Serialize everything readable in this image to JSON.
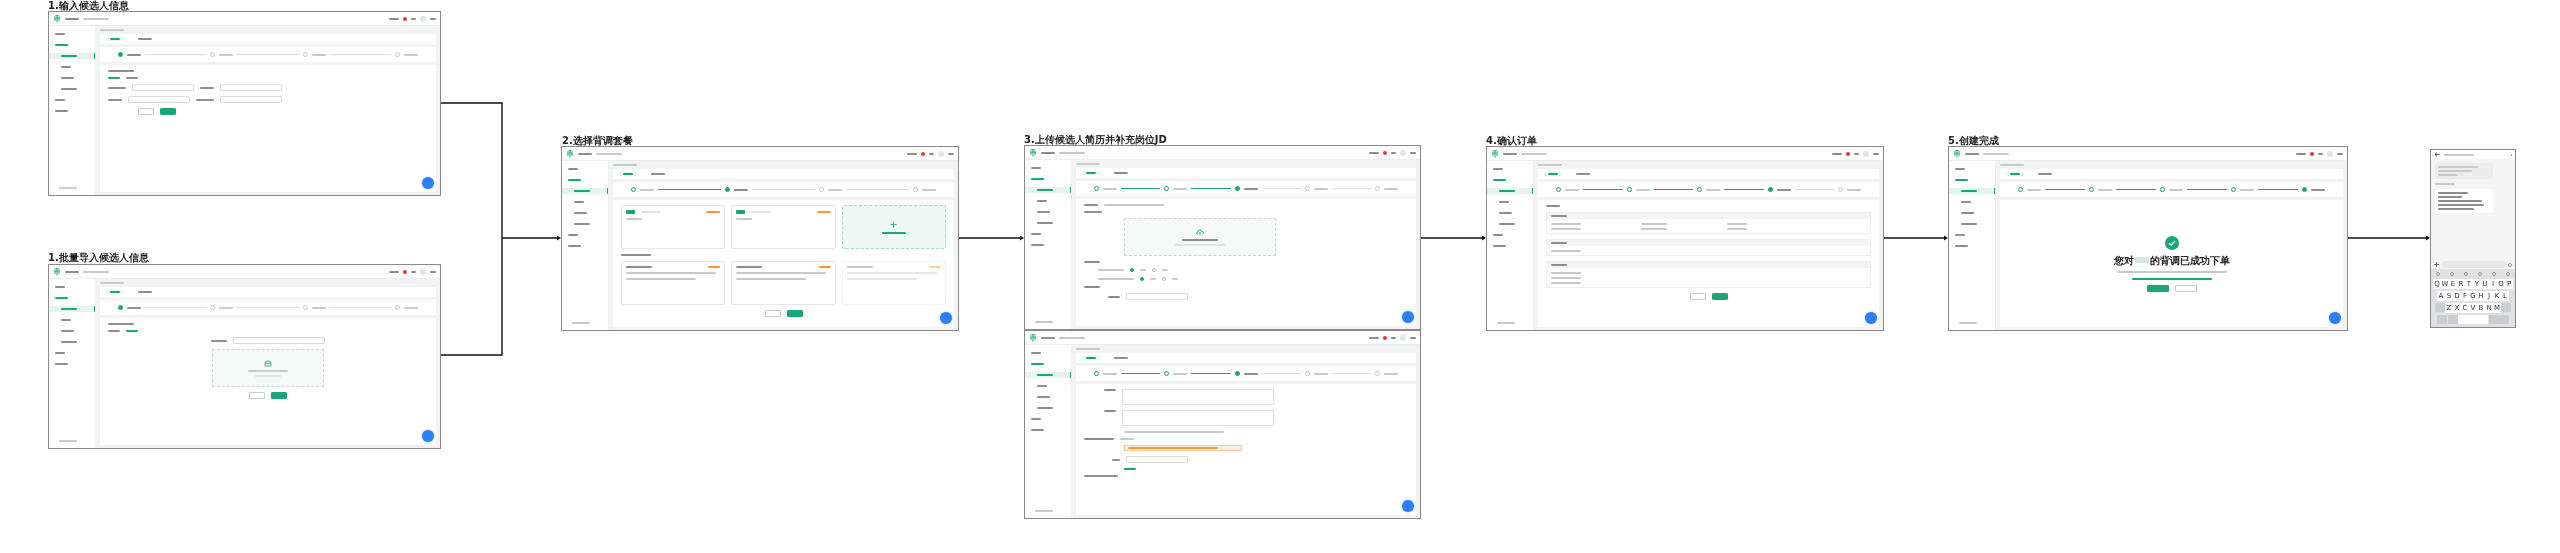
{
  "frames": [
    {
      "title": "1.输入候选人信息",
      "kind": "form",
      "sidebar": [
        {
          "selected": false
        },
        {
          "selected": false
        },
        {
          "selected": true
        },
        {
          "selected": false
        },
        {
          "selected": false
        },
        {
          "selected": false
        },
        {
          "selected": false
        },
        {
          "selected": false
        }
      ],
      "steps": [
        {
          "done": false,
          "current": true
        },
        {
          "done": false,
          "current": false
        },
        {
          "done": false,
          "current": false
        },
        {
          "done": false,
          "current": false
        }
      ]
    },
    {
      "title": "1.批量导入候选人信息",
      "kind": "upload",
      "sidebar": [
        {
          "selected": false
        },
        {
          "selected": false
        },
        {
          "selected": true
        },
        {
          "selected": false
        },
        {
          "selected": false
        },
        {
          "selected": false
        },
        {
          "selected": false
        },
        {
          "selected": false
        }
      ],
      "steps": [
        {
          "done": false,
          "current": true
        },
        {
          "done": false,
          "current": false
        },
        {
          "done": false,
          "current": false
        },
        {
          "done": false,
          "current": false
        }
      ]
    },
    {
      "title": "2.选择背调套餐",
      "kind": "packages",
      "sidebar": [
        {
          "selected": false
        },
        {
          "selected": false
        },
        {
          "selected": true
        },
        {
          "selected": false
        },
        {
          "selected": false
        },
        {
          "selected": false
        },
        {
          "selected": false
        },
        {
          "selected": false
        }
      ],
      "steps": [
        {
          "done": true,
          "current": false
        },
        {
          "done": false,
          "current": true
        },
        {
          "done": false,
          "current": false
        },
        {
          "done": false,
          "current": false
        }
      ]
    },
    {
      "title": "3.上传候选人简历并补充岗位JD",
      "kind": "resume",
      "sidebar": [
        {
          "selected": false
        },
        {
          "selected": false
        },
        {
          "selected": true
        },
        {
          "selected": false
        },
        {
          "selected": false
        },
        {
          "selected": false
        },
        {
          "selected": false
        },
        {
          "selected": false
        }
      ],
      "radios": [
        {
          "checked": true
        },
        {
          "checked": false
        },
        {
          "checked": true
        },
        {
          "checked": false
        }
      ],
      "steps": [
        {
          "done": true,
          "current": false
        },
        {
          "done": true,
          "current": false
        },
        {
          "done": false,
          "current": true
        },
        {
          "done": false,
          "current": false
        },
        {
          "done": false,
          "current": false
        }
      ]
    },
    {
      "kind": "resume-more",
      "sidebar": [
        {
          "selected": false
        },
        {
          "selected": false
        },
        {
          "selected": true
        },
        {
          "selected": false
        },
        {
          "selected": false
        },
        {
          "selected": false
        },
        {
          "selected": false
        },
        {
          "selected": false
        }
      ],
      "steps": [
        {
          "done": true,
          "current": false
        },
        {
          "done": true,
          "current": false
        },
        {
          "done": false,
          "current": true
        },
        {
          "done": false,
          "current": false
        },
        {
          "done": false,
          "current": false
        }
      ]
    },
    {
      "title": "4.确认订单",
      "kind": "confirm",
      "sidebar": [
        {
          "selected": false
        },
        {
          "selected": false
        },
        {
          "selected": true
        },
        {
          "selected": false
        },
        {
          "selected": false
        },
        {
          "selected": false
        },
        {
          "selected": false
        },
        {
          "selected": false
        }
      ],
      "steps": [
        {
          "done": true,
          "current": false
        },
        {
          "done": true,
          "current": false
        },
        {
          "done": true,
          "current": false
        },
        {
          "done": false,
          "current": true
        },
        {
          "done": false,
          "current": false
        }
      ]
    },
    {
      "title": "5.创建完成",
      "kind": "success",
      "message_start": "您对",
      "message_end": "的背调已成功下单",
      "sidebar": [
        {
          "selected": false
        },
        {
          "selected": false
        },
        {
          "selected": true
        },
        {
          "selected": false
        },
        {
          "selected": false
        },
        {
          "selected": false
        },
        {
          "selected": false
        },
        {
          "selected": false
        }
      ],
      "steps": [
        {
          "done": true,
          "current": false
        },
        {
          "done": true,
          "current": false
        },
        {
          "done": true,
          "current": false
        },
        {
          "done": true,
          "current": false
        },
        {
          "done": false,
          "current": true
        }
      ]
    }
  ],
  "phone": {
    "keyboard_rows": [
      [
        "Q",
        "W",
        "E",
        "R",
        "T",
        "Y",
        "U",
        "I",
        "O",
        "P"
      ],
      [
        "A",
        "S",
        "D",
        "F",
        "G",
        "H",
        "J",
        "K",
        "L"
      ],
      [
        "Z",
        "X",
        "C",
        "V",
        "B",
        "N",
        "M"
      ]
    ]
  }
}
